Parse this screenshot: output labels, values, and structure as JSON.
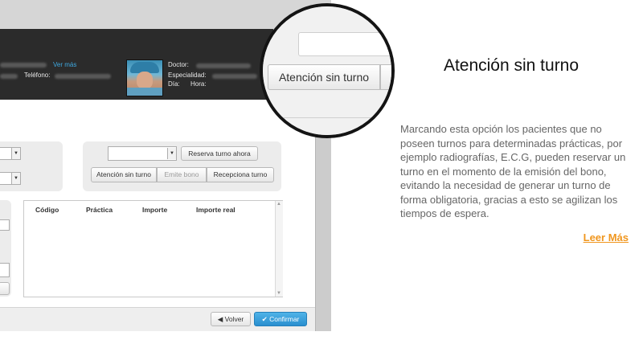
{
  "header": {
    "ver_mas": "Ver más",
    "telefono_label": "Teléfono:",
    "doctor_label": "Doctor:",
    "especialidad_label": "Especialidad:",
    "dia_label": "Día:",
    "hora_label": "Hora:"
  },
  "booking": {
    "reserva_label": "Reserva turno ahora",
    "tabs": [
      "Atención sin turno",
      "Emite bono",
      "Recepciona turno"
    ]
  },
  "table": {
    "columns": [
      "Código",
      "Práctica",
      "Importe",
      "Importe real"
    ]
  },
  "footer": {
    "volver_label": "Volver",
    "confirmar_label": "Confirmar"
  },
  "magnifier": {
    "button_label": "Atención sin turno"
  },
  "feature": {
    "title": "Atención sin turno",
    "description": "Marcando esta opción los pacientes que no poseen turnos para determinadas prácticas, por ejemplo radiografías, E.C.G, pueden reservar un turno en el momento de la emisión del bono, evitando la necesidad de generar un turno de forma obligatoria, gracias a esto se agilizan los tiempos de espera.",
    "read_more": "Leer Más"
  },
  "colors": {
    "accent": "#f0961e",
    "link": "#3fa9e0",
    "primary_button": "#2a8fcf"
  }
}
